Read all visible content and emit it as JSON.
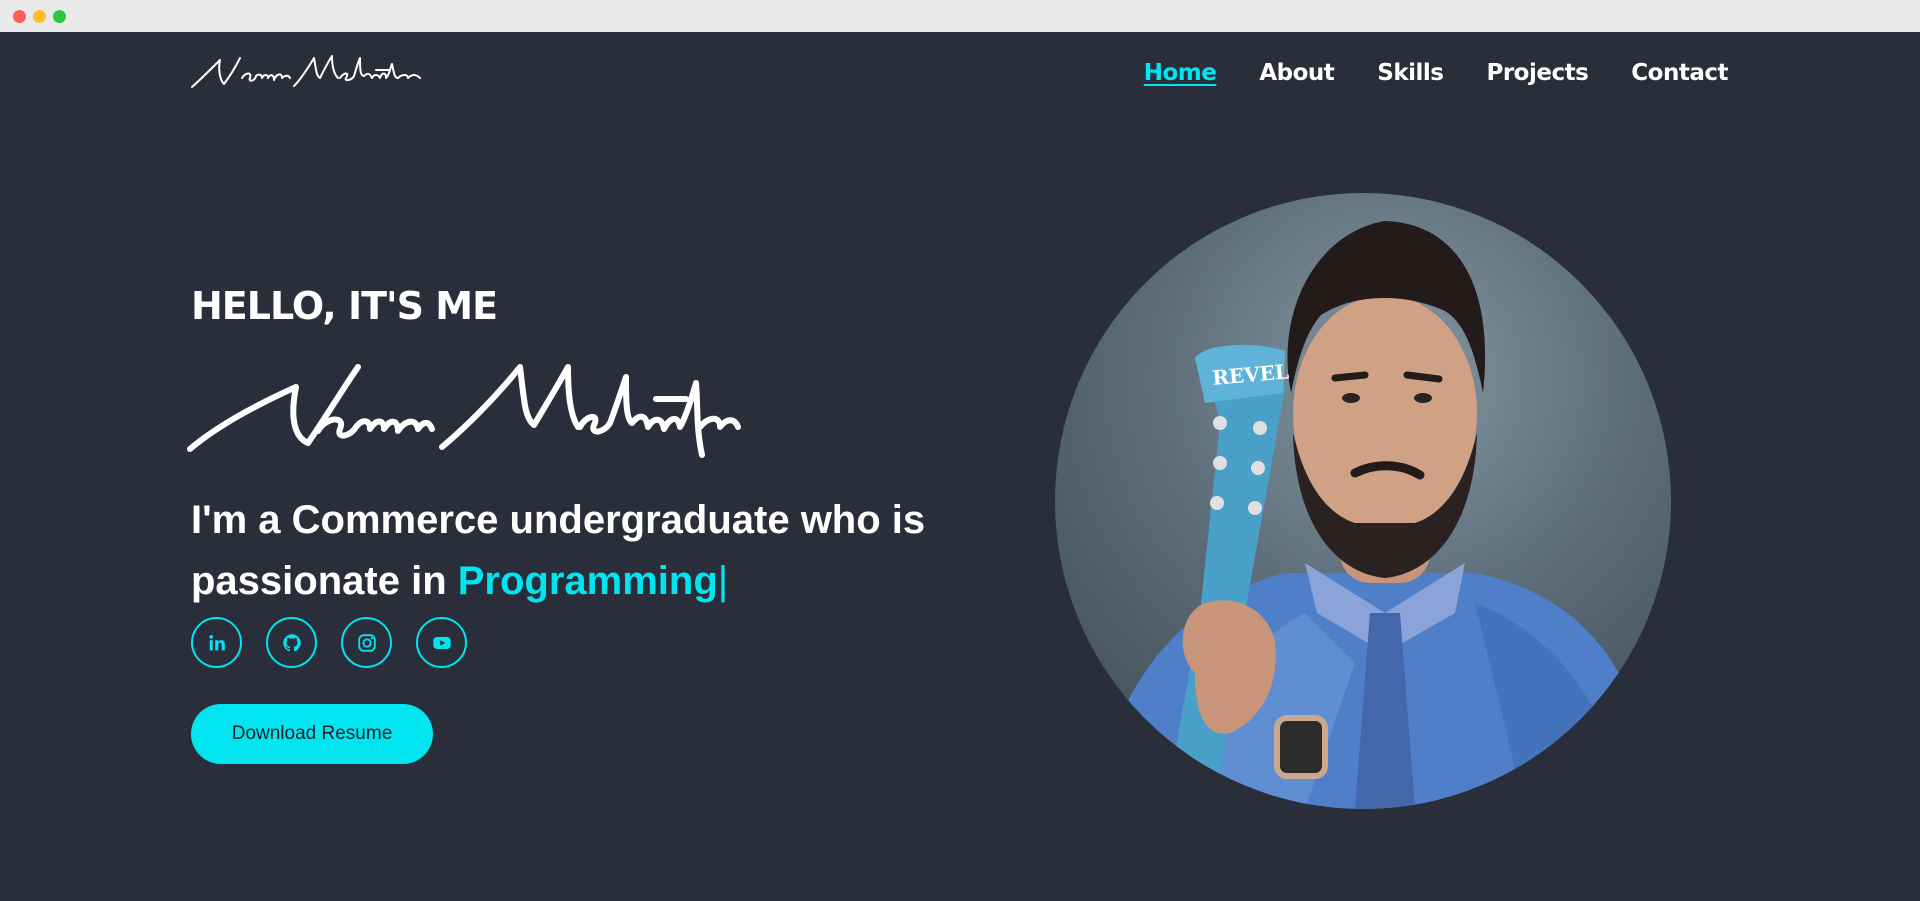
{
  "window": {
    "controls": [
      "close",
      "minimize",
      "maximize"
    ]
  },
  "header": {
    "logo_text": "Naman Mehrotra",
    "nav": [
      {
        "label": "Home",
        "active": true
      },
      {
        "label": "About",
        "active": false
      },
      {
        "label": "Skills",
        "active": false
      },
      {
        "label": "Projects",
        "active": false
      },
      {
        "label": "Contact",
        "active": false
      }
    ]
  },
  "hero": {
    "greeting": "HELLO, IT'S ME",
    "name": "Naman Mehrotra",
    "tagline_prefix": "I'm a Commerce undergraduate who is passionate in",
    "tagline_typed": "Programming",
    "cursor": "|",
    "socials": [
      "linkedin-icon",
      "github-icon",
      "instagram-icon",
      "youtube-icon"
    ],
    "download_button": "Download Resume"
  },
  "colors": {
    "background": "#2a2e3b",
    "accent": "#00e5f0",
    "text": "#ffffff"
  }
}
